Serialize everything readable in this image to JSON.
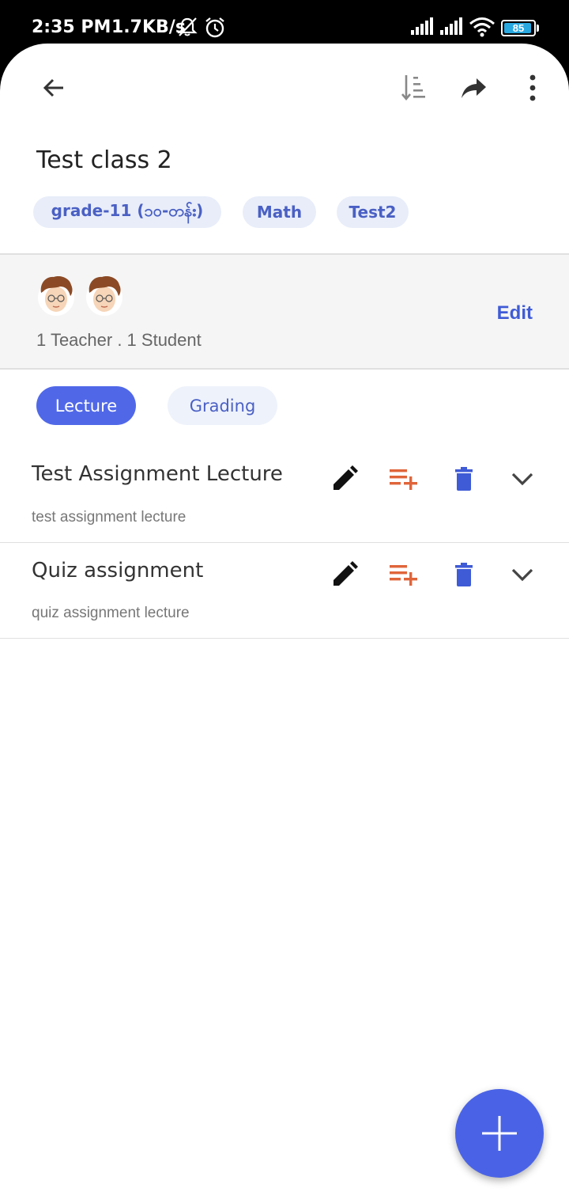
{
  "status_bar": {
    "time": "2:35 PM",
    "network_speed": "1.7KB/s",
    "battery_level": "85"
  },
  "app_bar": {
    "icons": [
      "back-arrow-icon",
      "sort-icon",
      "share-icon",
      "more-vert-icon"
    ]
  },
  "class": {
    "title": "Test class 2",
    "tags": [
      "grade-11 (၁၀-တန်း)",
      "Math",
      "Test2"
    ]
  },
  "members": {
    "summary": "1 Teacher . 1 Student",
    "edit_label": "Edit"
  },
  "tabs": [
    {
      "label": "Lecture",
      "active": true
    },
    {
      "label": "Grading",
      "active": false
    }
  ],
  "lectures": [
    {
      "title": "Test Assignment Lecture",
      "description": "test assignment lecture"
    },
    {
      "title": "Quiz assignment",
      "description": "quiz assignment lecture"
    }
  ],
  "colors": {
    "accent": "#4a63e6",
    "edit_icon": "#111111",
    "add_list_icon": "#e0653a",
    "delete_icon": "#3f5bd6"
  },
  "fab": {
    "icon": "plus-icon"
  }
}
